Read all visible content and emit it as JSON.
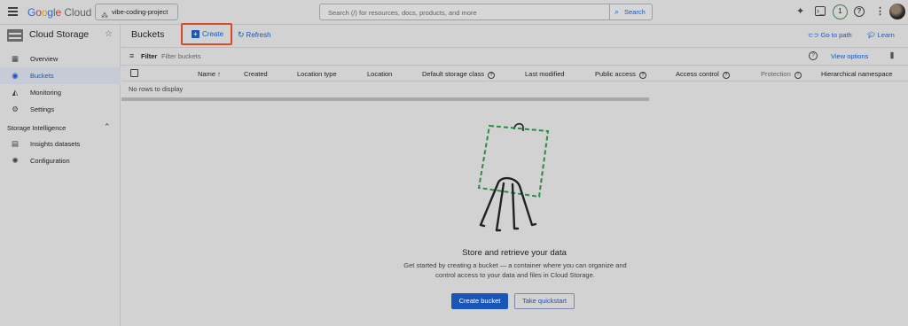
{
  "topbar": {
    "logo_parts": [
      "G",
      "o",
      "o",
      "g",
      "l",
      "e"
    ],
    "logo_cloud": "Cloud",
    "project": "vibe-coding-project",
    "search_placeholder": "Search (/) for resources, docs, products, and more",
    "search_button": "Search",
    "notification_count": "1",
    "help": "?",
    "icons": [
      "menu-icon",
      "project-icon",
      "gemini-icon",
      "terminal-icon",
      "help-icon",
      "more-icon"
    ]
  },
  "sidebar": {
    "title": "Cloud Storage",
    "items": [
      {
        "label": "Overview",
        "icon": "overview-icon"
      },
      {
        "label": "Buckets",
        "icon": "bucket-icon"
      },
      {
        "label": "Monitoring",
        "icon": "monitoring-icon"
      },
      {
        "label": "Settings",
        "icon": "settings-icon"
      }
    ],
    "section": "Storage Intelligence",
    "section_items": [
      {
        "label": "Insights datasets",
        "icon": "dataset-icon"
      },
      {
        "label": "Configuration",
        "icon": "configuration-icon"
      }
    ]
  },
  "toolbar": {
    "title": "Buckets",
    "create": "Create",
    "refresh": "Refresh",
    "go_to_path": "Go to path",
    "learn": "Learn"
  },
  "filter": {
    "label": "Filter",
    "placeholder": "Filter buckets",
    "view_options": "View options"
  },
  "table": {
    "columns": [
      "Name",
      "Created",
      "Location type",
      "Location",
      "Default storage class",
      "Last modified",
      "Public access",
      "Access control",
      "Protection",
      "Hierarchical namespace"
    ],
    "empty": "No rows to display"
  },
  "empty_state": {
    "title": "Store and retrieve your data",
    "description": "Get started by creating a bucket — a container where you can organize and control access to your data and files in Cloud Storage.",
    "primary_button": "Create bucket",
    "secondary_button": "Take quickstart"
  },
  "colors": {
    "accent": "#1a56b8",
    "highlight": "#d94a2b",
    "illustration_green": "#2e8b47"
  }
}
